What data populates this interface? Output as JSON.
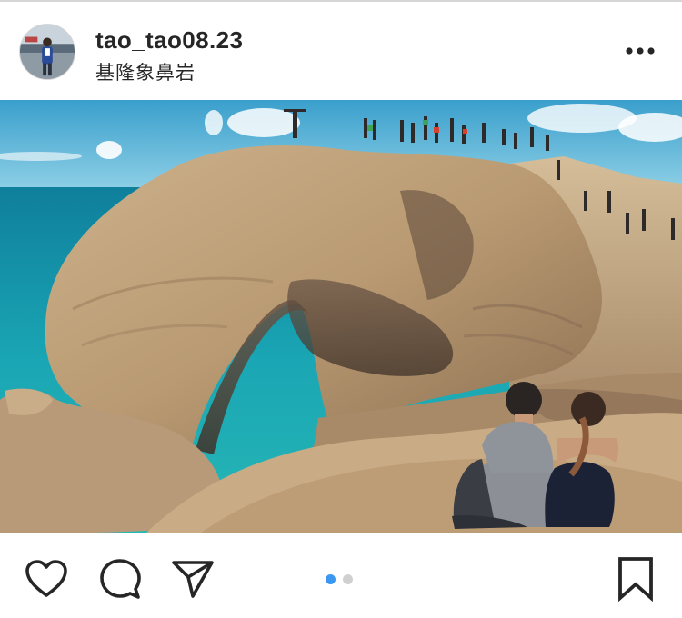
{
  "post": {
    "username": "tao_tao08.23",
    "location": "基隆象鼻岩"
  },
  "header": {
    "more_icon": "more-horizontal-icon"
  },
  "carousel": {
    "current": 1,
    "total": 2,
    "active_color": "#3b97f0",
    "inactive_color": "#d0d0d0"
  },
  "actions": {
    "like_icon": "heart-icon",
    "comment_icon": "comment-bubble-icon",
    "share_icon": "paper-plane-icon",
    "save_icon": "bookmark-icon"
  },
  "colors": {
    "text": "#262626",
    "sea": "#1aa3b3",
    "sky": "#59b6d8",
    "rock": "#c6ab84"
  }
}
